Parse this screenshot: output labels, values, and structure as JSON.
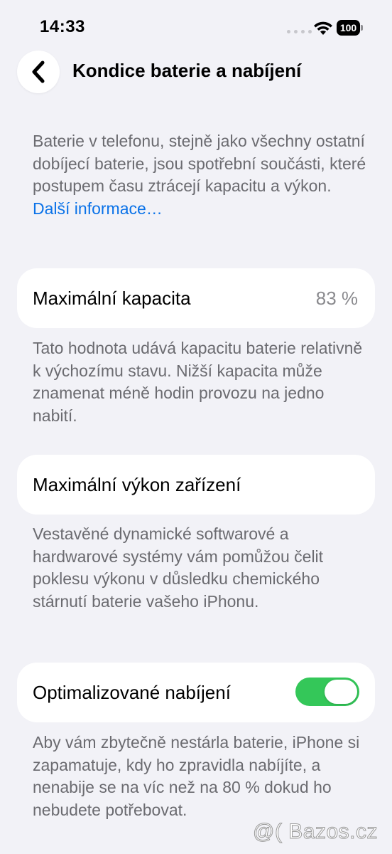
{
  "status_bar": {
    "time": "14:33",
    "battery_level": "100",
    "icons": [
      "cellular-signal-icon",
      "wifi-icon",
      "battery-icon"
    ]
  },
  "nav": {
    "back_icon": "chevron-left-icon",
    "title": "Kondice baterie a nabíjení"
  },
  "intro": {
    "text": "Baterie v telefonu, stejně jako všechny ostatní dobíjecí baterie, jsou spotřební součásti, které postupem času ztrácejí kapacitu a výkon.",
    "link_label": "Další informace…"
  },
  "max_capacity": {
    "label": "Maximální kapacita",
    "value": "83 %",
    "footer": "Tato hodnota udává kapacitu baterie relativně k výchozímu stavu. Nižší kapacita může znamenat méně hodin provozu na jedno nabití."
  },
  "peak_performance": {
    "label": "Maximální výkon zařízení",
    "footer": "Vestavěné dynamické softwarové a hardwarové systémy vám pomůžou čelit poklesu výkonu v důsledku chemického stárnutí baterie vašeho iPhonu."
  },
  "optimized_charging": {
    "label": "Optimalizované nabíjení",
    "enabled": true,
    "footer": "Aby vám zbytečně nestárla baterie, iPhone si zapamatuje, kdy ho zpravidla nabíjíte, a nenabije se na víc než na 80 % dokud ho nebudete potřebovat."
  },
  "watermark": "@( Bazos.cz",
  "colors": {
    "background": "#f2f2f7",
    "card": "#ffffff",
    "link": "#0a72e8",
    "toggle_on": "#34c759",
    "secondary_text": "#6b6b70"
  }
}
